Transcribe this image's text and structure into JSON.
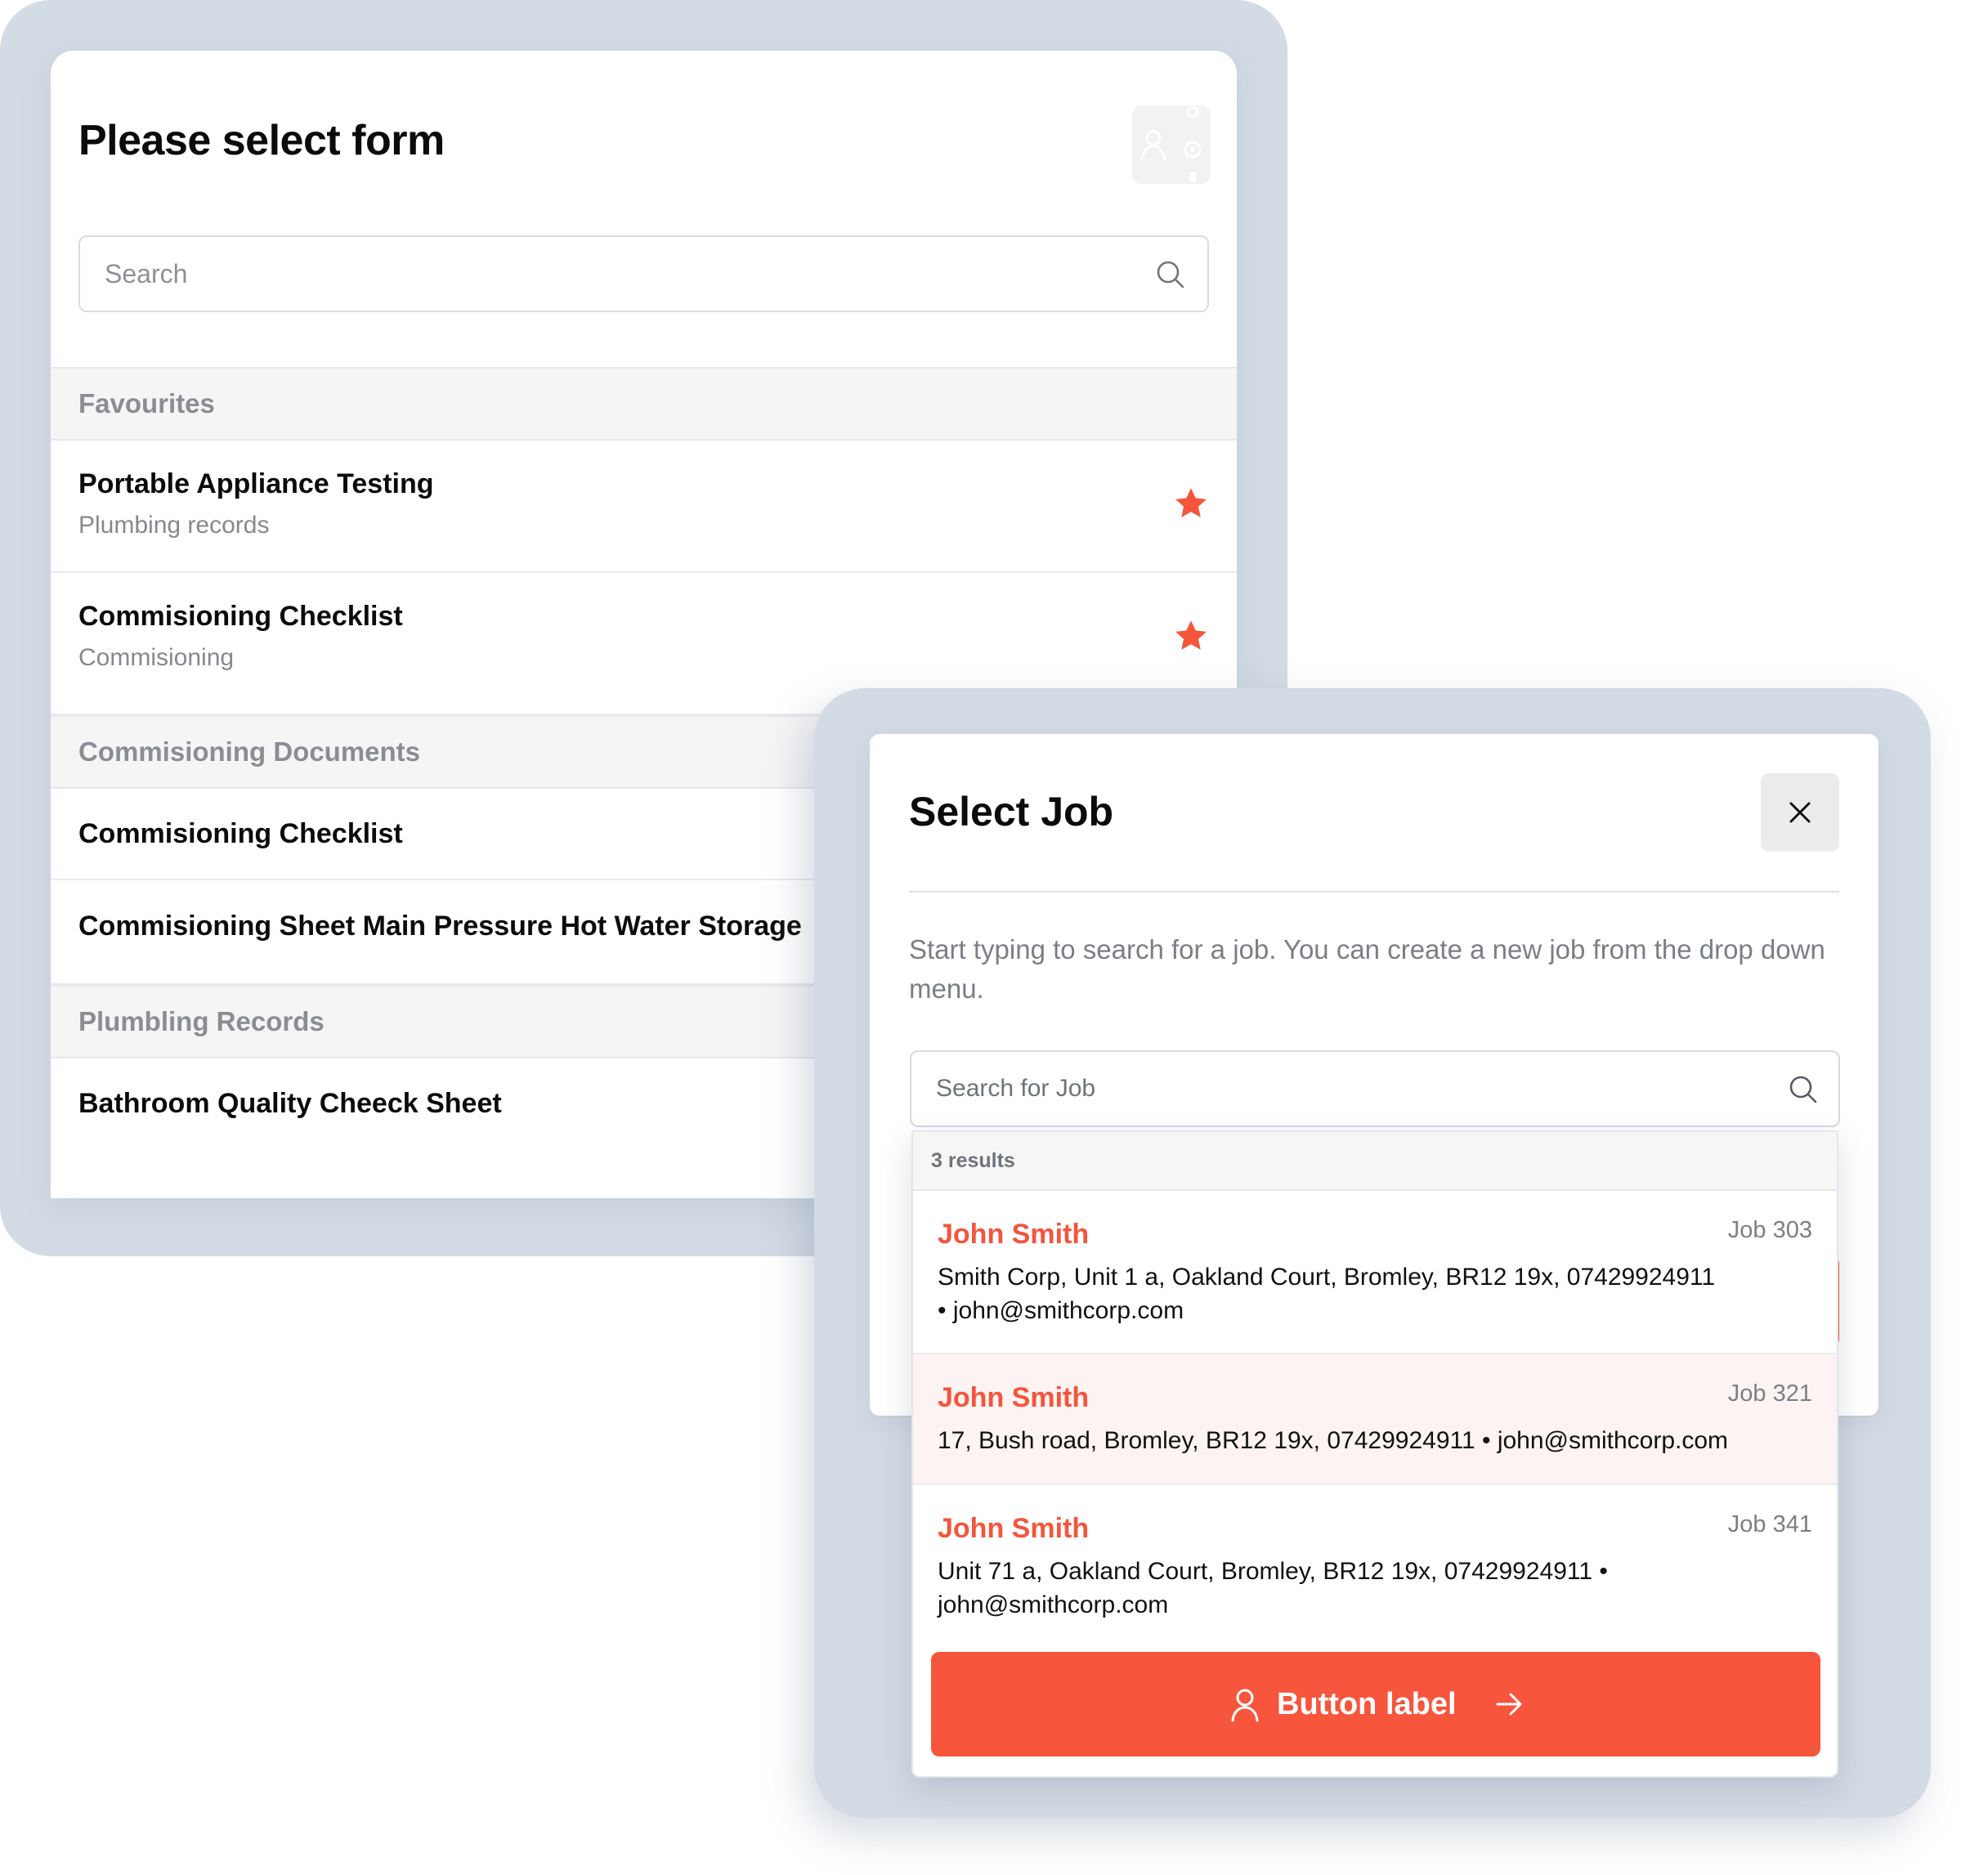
{
  "form_panel": {
    "title": "Please select form",
    "search_placeholder": "Search",
    "sections": [
      {
        "heading": "Favourites",
        "items": [
          {
            "title": "Portable Appliance Testing",
            "subtitle": "Plumbing records",
            "favourite": true
          },
          {
            "title": "Commisioning Checklist",
            "subtitle": "Commisioning",
            "favourite": true
          }
        ]
      },
      {
        "heading": "Commisioning Documents",
        "items": [
          {
            "title": "Commisioning Checklist"
          },
          {
            "title": "Commisioning Sheet Main Pressure Hot Water Storage"
          }
        ]
      },
      {
        "heading": "Plumbling Records",
        "items": [
          {
            "title": "Bathroom Quality Cheeck Sheet"
          }
        ]
      }
    ],
    "icons": {
      "search": "search-icon",
      "favourite": "star-icon",
      "account": "user-settings-icon"
    }
  },
  "job_panel": {
    "title": "Select Job",
    "description": "Start typing to search for a job. You can create a new job from the drop down menu.",
    "search_placeholder": "Search for Job",
    "results_label": "3 results",
    "results": [
      {
        "name": "John Smith",
        "job": "Job 303",
        "details": "Smith Corp, Unit 1 a, Oakland Court, Bromley, BR12 19x, 07429924911 • john@smithcorp.com",
        "highlighted": false
      },
      {
        "name": "John Smith",
        "job": "Job 321",
        "details": "17, Bush road, Bromley, BR12 19x, 07429924911 • john@smithcorp.com",
        "highlighted": true
      },
      {
        "name": "John Smith",
        "job": "Job 341",
        "details": "Unit 71 a, Oakland Court, Bromley, BR12 19x, 07429924911 • john@smithcorp.com",
        "highlighted": false
      }
    ],
    "button_label": "Button label",
    "icons": {
      "close": "close-icon",
      "search": "search-icon",
      "button_leading": "user-icon",
      "button_trailing": "arrow-right-icon"
    }
  },
  "colors": {
    "accent": "#f4553b",
    "frame": "#d3dbe4",
    "muted_text": "#85898f",
    "highlight_row": "#fdf3f2"
  }
}
